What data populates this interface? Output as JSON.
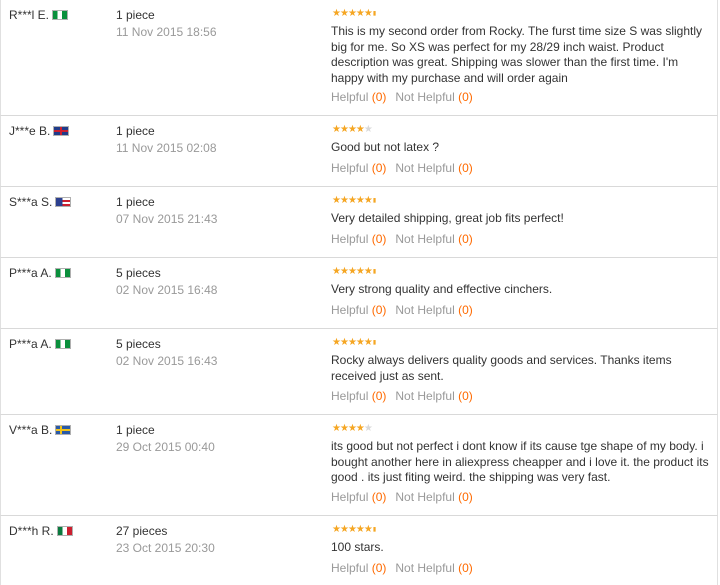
{
  "colors": {
    "star": "#f5a623",
    "count": "#ff6a00",
    "muted": "#999999"
  },
  "helpful_label": "Helpful",
  "not_helpful_label": "Not Helpful",
  "reviews": [
    {
      "user": "R***l E.",
      "flag": "nigeria-flag-icon",
      "quantity": "1 piece",
      "date": "11 Nov 2015 18:56",
      "rating": 5,
      "comment": "This is my second order from Rocky. The furst time size S was slightly big for me. So XS was perfect for my 28/29 inch waist. Product description was great. Shipping was slower than the first time. I'm happy with my purchase and will order again",
      "helpful_count": "(0)",
      "not_helpful_count": "(0)"
    },
    {
      "user": "J***e B.",
      "flag": "uk-flag-icon",
      "quantity": "1 piece",
      "date": "11 Nov 2015 02:08",
      "rating": 4,
      "comment": "Good but not latex ?",
      "helpful_count": "(0)",
      "not_helpful_count": "(0)"
    },
    {
      "user": "S***a S.",
      "flag": "us-flag-icon",
      "quantity": "1 piece",
      "date": "07 Nov 2015 21:43",
      "rating": 5,
      "comment": "Very detailed shipping, great job fits perfect!",
      "helpful_count": "(0)",
      "not_helpful_count": "(0)"
    },
    {
      "user": "P***a A.",
      "flag": "nigeria-flag-icon",
      "quantity": "5 pieces",
      "date": "02 Nov 2015 16:48",
      "rating": 5,
      "comment": "Very strong quality and effective cinchers.",
      "helpful_count": "(0)",
      "not_helpful_count": "(0)"
    },
    {
      "user": "P***a A.",
      "flag": "nigeria-flag-icon",
      "quantity": "5 pieces",
      "date": "02 Nov 2015 16:43",
      "rating": 5,
      "comment": "Rocky always delivers quality goods and services. Thanks items received just as sent.",
      "helpful_count": "(0)",
      "not_helpful_count": "(0)"
    },
    {
      "user": "V***a B.",
      "flag": "sweden-flag-icon",
      "quantity": "1 piece",
      "date": "29 Oct 2015 00:40",
      "rating": 4,
      "comment": "its good but not perfect i dont know if its cause tge shape of my body. i bought another here in aliexpress cheapper and i love it. the product its good . its just fiting weird. the shipping was very fast.",
      "helpful_count": "(0)",
      "not_helpful_count": "(0)"
    },
    {
      "user": "D***h R.",
      "flag": "mexico-flag-icon",
      "quantity": "27 pieces",
      "date": "23 Oct 2015 20:30",
      "rating": 5,
      "comment": "100 stars.",
      "helpful_count": "(0)",
      "not_helpful_count": "(0)"
    }
  ]
}
